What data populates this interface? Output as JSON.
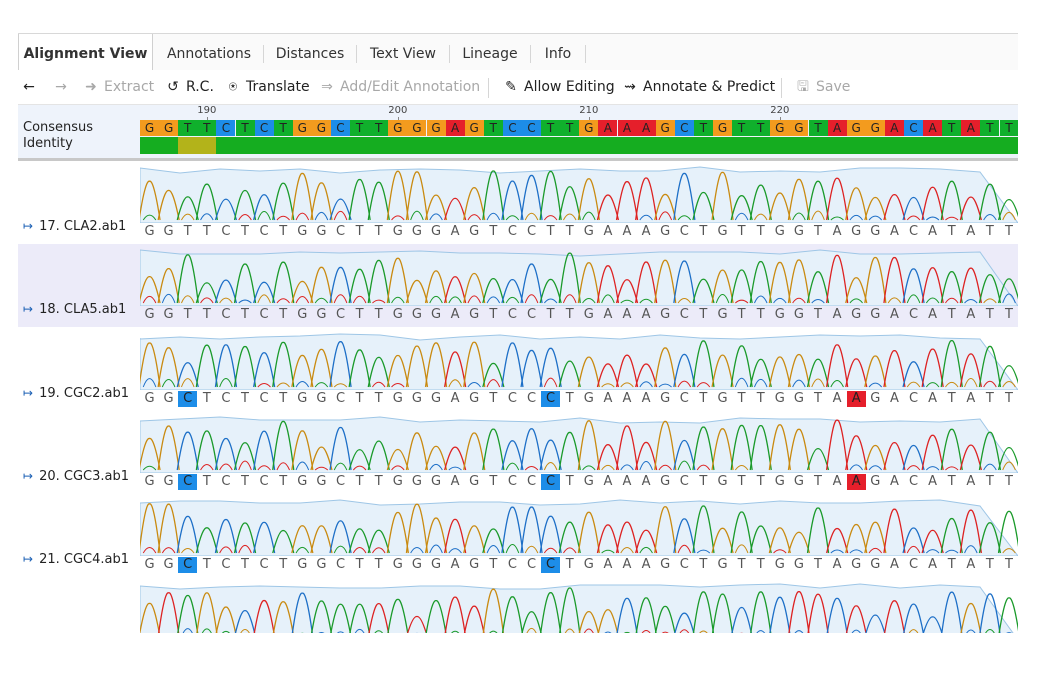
{
  "tabs": [
    {
      "label": "Alignment View",
      "active": true
    },
    {
      "label": "Annotations",
      "active": false
    },
    {
      "label": "Distances",
      "active": false
    },
    {
      "label": "Text View",
      "active": false
    },
    {
      "label": "Lineage",
      "active": false
    },
    {
      "label": "Info",
      "active": false
    }
  ],
  "toolbar": {
    "back_icon": "arrow-left-icon",
    "forward_icon": "arrow-right-icon",
    "extract_label": "Extract",
    "rc_label": "R.C.",
    "translate_label": "Translate",
    "add_edit_annotation_label": "Add/Edit Annotation",
    "allow_editing_label": "Allow Editing",
    "annotate_predict_label": "Annotate & Predict",
    "save_label": "Save"
  },
  "consensus": {
    "label_line1": "Consensus",
    "label_line2": "Identity",
    "ruler_ticks": [
      "190",
      "200",
      "210",
      "220"
    ],
    "sequence": "GGTTCTCTGGCTTGGGAGTCCTTGAAAGCTGTTGGTAGGACATATT",
    "identity": "HHLLHHHHHHHHHHHHHHHHHHHHHHHHHHHHHHHHHHHHHHHHHH"
  },
  "colors": {
    "A": "#e51f2b",
    "C": "#1d8de8",
    "G": "#f39b1e",
    "T": "#10b02c",
    "identity_full": "#15ad20",
    "identity_partial": "#b3b31a"
  },
  "tracks": [
    {
      "name": "17. CLA2.ab1",
      "calls": "GGTTCTCTGGCTTGGGAGTCCTTGAAAGCTGTTGGTAGGACATATT",
      "mismatches": []
    },
    {
      "name": "18. CLA5.ab1",
      "calls": "GGTTCTCTGGCTTGGGAGTCCTTGAAAGCTGTTGGTAGGACATATT",
      "mismatches": []
    },
    {
      "name": "19. CGC2.ab1",
      "calls": "GGCTCTCTGGCTTGGGAGTCCCTGAAAGCTGTTGGTAAGACATATT",
      "mismatches": [
        2,
        21,
        37
      ]
    },
    {
      "name": "20. CGC3.ab1",
      "calls": "GGCTCTCTGGCTTGGGAGTCCCTGAAAGCTGTTGGTAAGACATATT",
      "mismatches": [
        2,
        21,
        37
      ]
    },
    {
      "name": "21. CGC4.ab1",
      "calls": "GGCTCTCTGGCTTGGGAGTCCCTGAAAGCTGTTGGTAGGACATATT",
      "mismatches": [
        2,
        21
      ]
    },
    {
      "name": "",
      "calls": "",
      "mismatches": []
    }
  ]
}
